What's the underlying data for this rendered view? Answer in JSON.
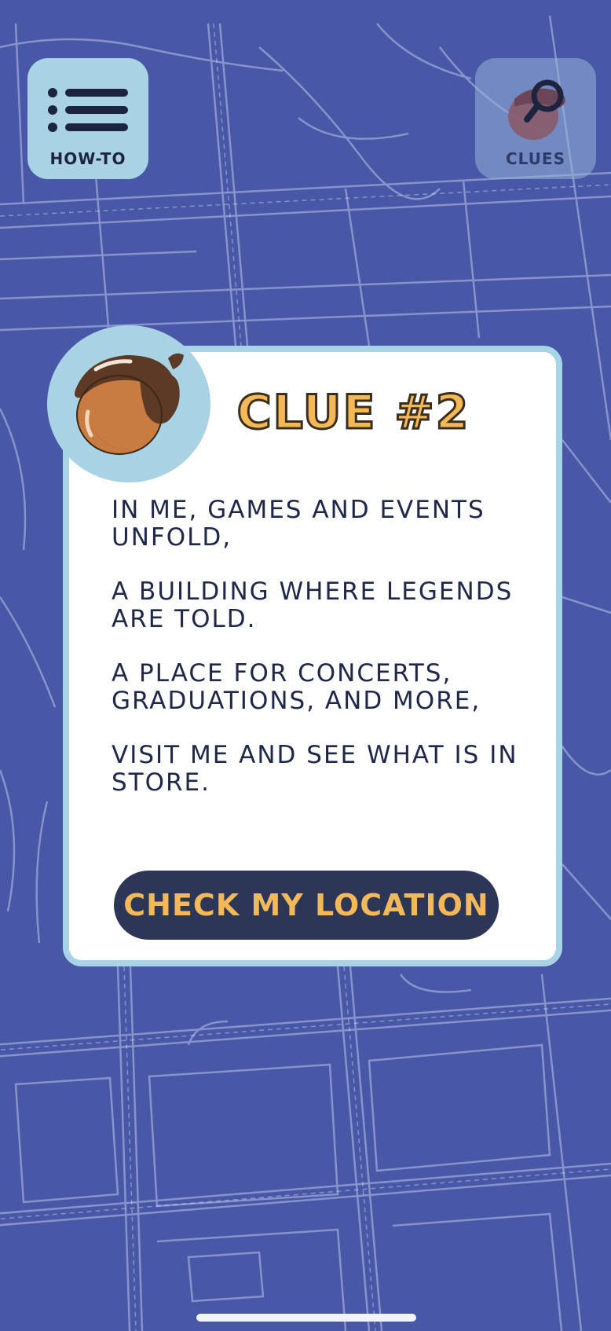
{
  "toolbar": {
    "howto_label": "HOW-TO",
    "clues_label": "CLUES"
  },
  "clue": {
    "title": "CLUE #2",
    "paragraphs": [
      "IN ME, GAMES AND EVENTS UNFOLD,",
      "A BUILDING WHERE LEGENDS ARE TOLD.",
      "A PLACE FOR CONCERTS, GRADUATIONS, AND MORE,",
      "VISIT ME AND SEE WHAT IS IN STORE."
    ],
    "check_button_label": "CHECK MY LOCATION"
  },
  "icons": {
    "howto": "list-icon",
    "clues": "acorn-magnifier-icon",
    "badge": "acorn-icon"
  },
  "colors": {
    "map_background": "#4857a6",
    "accent_yellow": "#f4b857",
    "card_border": "#a7d4e6",
    "button_dark": "#2c3758"
  }
}
